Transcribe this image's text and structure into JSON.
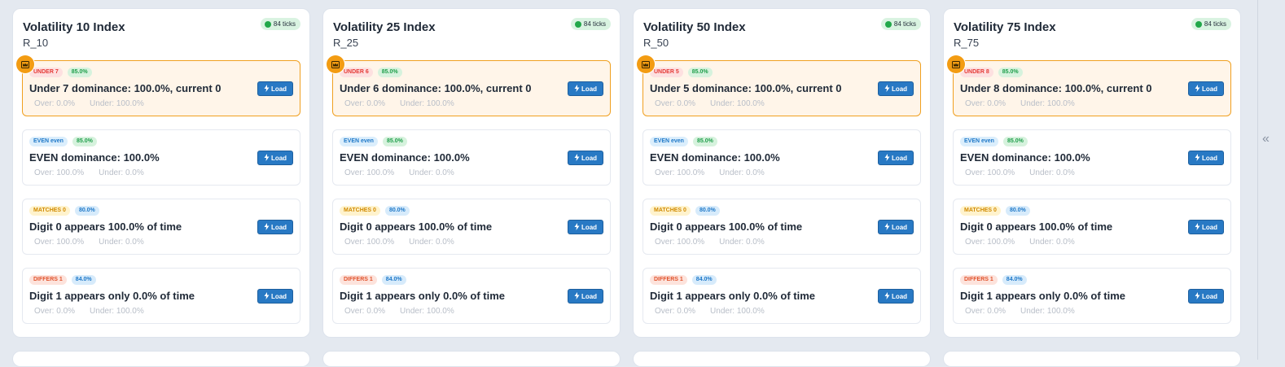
{
  "colors": {
    "under_tag_bg": "#fde0e0",
    "under_tag_fg": "#e53935",
    "even_tag_bg": "#dbeefc",
    "even_tag_fg": "#1e78c8",
    "matches_tag_bg": "#fff3cd",
    "matches_tag_fg": "#d18a00",
    "differs_tag_bg": "#fde3dc",
    "differs_tag_fg": "#e0522b",
    "conf_85_bg": "#d6f2dd",
    "conf_85_fg": "#1e9e4a",
    "conf_blue_bg": "#d7ebfb",
    "conf_blue_fg": "#1e78c8",
    "load_bg": "#2879c4",
    "crown": "#f39c12"
  },
  "load_label": "Load",
  "collapse_label": "«",
  "markets": [
    {
      "title": "Volatility 10 Index",
      "symbol": "R_10",
      "ticks": "84 ticks",
      "signals": [
        {
          "tag": "UNDER 7",
          "conf": "85.0%",
          "text": "Under 7 dominance: 100.0%, current 0",
          "over": "Over: 0.0%",
          "under": "Under: 100.0%"
        },
        {
          "tag": "EVEN even",
          "conf": "85.0%",
          "text": "EVEN dominance: 100.0%",
          "over": "Over: 100.0%",
          "under": "Under: 0.0%"
        },
        {
          "tag": "MATCHES 0",
          "conf": "80.0%",
          "text": "Digit 0 appears 100.0% of time",
          "over": "Over: 100.0%",
          "under": "Under: 0.0%"
        },
        {
          "tag": "DIFFERS 1",
          "conf": "84.0%",
          "text": "Digit 1 appears only 0.0% of time",
          "over": "Over: 0.0%",
          "under": "Under: 100.0%"
        }
      ]
    },
    {
      "title": "Volatility 25 Index",
      "symbol": "R_25",
      "ticks": "84 ticks",
      "signals": [
        {
          "tag": "UNDER 6",
          "conf": "85.0%",
          "text": "Under 6 dominance: 100.0%, current 0",
          "over": "Over: 0.0%",
          "under": "Under: 100.0%"
        },
        {
          "tag": "EVEN even",
          "conf": "85.0%",
          "text": "EVEN dominance: 100.0%",
          "over": "Over: 100.0%",
          "under": "Under: 0.0%"
        },
        {
          "tag": "MATCHES 0",
          "conf": "80.0%",
          "text": "Digit 0 appears 100.0% of time",
          "over": "Over: 100.0%",
          "under": "Under: 0.0%"
        },
        {
          "tag": "DIFFERS 1",
          "conf": "84.0%",
          "text": "Digit 1 appears only 0.0% of time",
          "over": "Over: 0.0%",
          "under": "Under: 100.0%"
        }
      ]
    },
    {
      "title": "Volatility 50 Index",
      "symbol": "R_50",
      "ticks": "84 ticks",
      "signals": [
        {
          "tag": "UNDER 5",
          "conf": "85.0%",
          "text": "Under 5 dominance: 100.0%, current 0",
          "over": "Over: 0.0%",
          "under": "Under: 100.0%"
        },
        {
          "tag": "EVEN even",
          "conf": "85.0%",
          "text": "EVEN dominance: 100.0%",
          "over": "Over: 100.0%",
          "under": "Under: 0.0%"
        },
        {
          "tag": "MATCHES 0",
          "conf": "80.0%",
          "text": "Digit 0 appears 100.0% of time",
          "over": "Over: 100.0%",
          "under": "Under: 0.0%"
        },
        {
          "tag": "DIFFERS 1",
          "conf": "84.0%",
          "text": "Digit 1 appears only 0.0% of time",
          "over": "Over: 0.0%",
          "under": "Under: 100.0%"
        }
      ]
    },
    {
      "title": "Volatility 75 Index",
      "symbol": "R_75",
      "ticks": "84 ticks",
      "signals": [
        {
          "tag": "UNDER 8",
          "conf": "85.0%",
          "text": "Under 8 dominance: 100.0%, current 0",
          "over": "Over: 0.0%",
          "under": "Under: 100.0%"
        },
        {
          "tag": "EVEN even",
          "conf": "85.0%",
          "text": "EVEN dominance: 100.0%",
          "over": "Over: 100.0%",
          "under": "Under: 0.0%"
        },
        {
          "tag": "MATCHES 0",
          "conf": "80.0%",
          "text": "Digit 0 appears 100.0% of time",
          "over": "Over: 100.0%",
          "under": "Under: 0.0%"
        },
        {
          "tag": "DIFFERS 1",
          "conf": "84.0%",
          "text": "Digit 1 appears only 0.0% of time",
          "over": "Over: 0.0%",
          "under": "Under: 100.0%"
        }
      ]
    }
  ]
}
